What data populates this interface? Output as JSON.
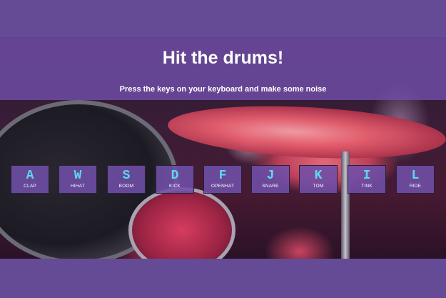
{
  "header": {
    "title": "Hit the drums!",
    "subtitle": "Press the keys on your keyboard and make some noise"
  },
  "keys": [
    {
      "letter": "A",
      "sound": "CLAP"
    },
    {
      "letter": "W",
      "sound": "HIHAT"
    },
    {
      "letter": "S",
      "sound": "BOOM"
    },
    {
      "letter": "D",
      "sound": "KICK"
    },
    {
      "letter": "F",
      "sound": "OPENHAT"
    },
    {
      "letter": "J",
      "sound": "SNARE"
    },
    {
      "letter": "K",
      "sound": "TOM"
    },
    {
      "letter": "I",
      "sound": "TINK"
    },
    {
      "letter": "L",
      "sound": "RIDE"
    }
  ],
  "colors": {
    "background": "#654a96",
    "overlay": "#704ea8",
    "key_letter": "#5fd8ea",
    "text": "#ffffff"
  }
}
